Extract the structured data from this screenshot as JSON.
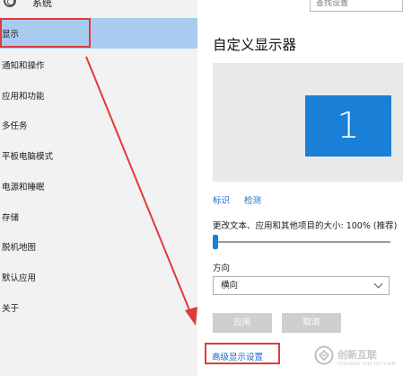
{
  "header": {
    "title": "系统",
    "search_placeholder": "查找设置"
  },
  "sidebar": {
    "items": [
      {
        "label": "显示"
      },
      {
        "label": "通知和操作"
      },
      {
        "label": "应用和功能"
      },
      {
        "label": "多任务"
      },
      {
        "label": "平板电脑模式"
      },
      {
        "label": "电源和睡眠"
      },
      {
        "label": "存储"
      },
      {
        "label": "脱机地图"
      },
      {
        "label": "默认应用"
      },
      {
        "label": "关于"
      }
    ]
  },
  "main": {
    "title": "自定义显示器",
    "monitor_number": "1",
    "links": {
      "identify": "标识",
      "detect": "检测"
    },
    "scale_label": "更改文本、应用和其他项目的大小: 100% (推荐)",
    "scale_value_percent": 0,
    "orientation_label": "方向",
    "orientation_value": "横向",
    "buttons": {
      "apply": "应用",
      "cancel": "取消"
    },
    "advanced_link": "高级显示设置"
  },
  "watermark": {
    "name": "创新互联",
    "sub": "CHUANG XIN HU LIAN"
  },
  "colors": {
    "accent": "#1a7fd6",
    "selected": "#a9cbef",
    "annotation": "#e03b3b",
    "link": "#1a6dc4"
  }
}
